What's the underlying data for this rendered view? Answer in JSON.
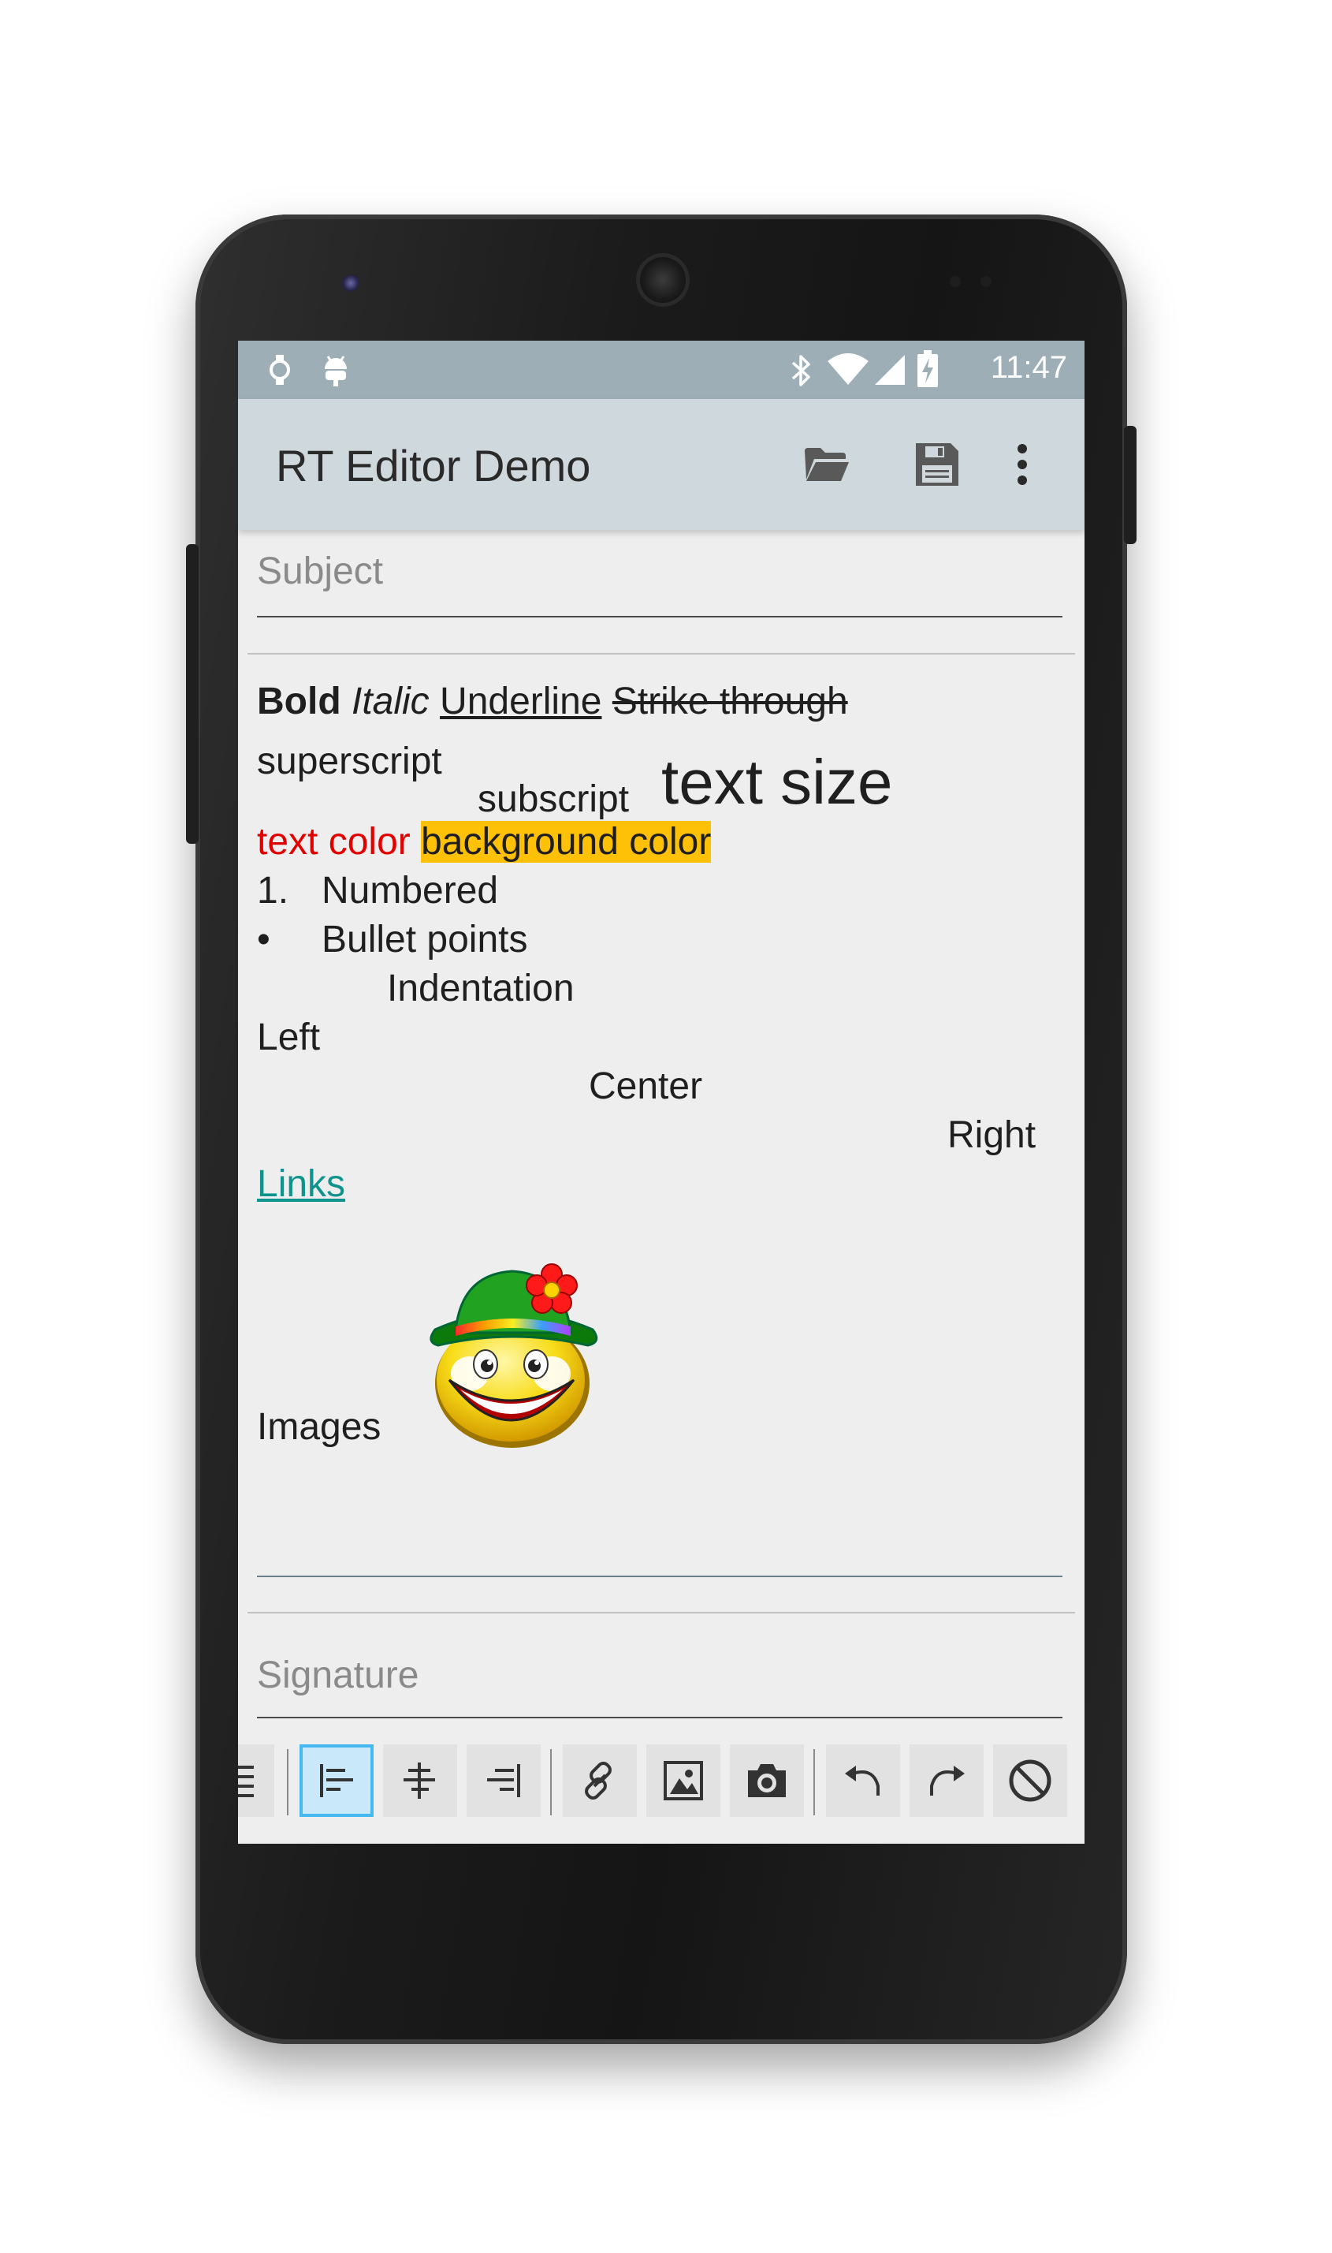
{
  "statusbar": {
    "time": "11:47",
    "icons": [
      "watch-icon",
      "android-icon",
      "bluetooth-icon",
      "wifi-icon",
      "signal-icon",
      "battery-icon"
    ]
  },
  "appbar": {
    "title": "RT Editor Demo",
    "actions": [
      "folder-open-icon",
      "save-icon",
      "more-vert-icon"
    ]
  },
  "subject": {
    "placeholder": "Subject"
  },
  "editor": {
    "bold": "Bold",
    "italic": "Italic",
    "underline": "Underline",
    "strike": "Strike through",
    "superscript": "superscript",
    "subscript": "subscript",
    "text_size": "text size",
    "text_color": "text color",
    "background_color": "background color",
    "numbered_marker": "1.",
    "numbered_label": "Numbered",
    "bullet_marker": "•",
    "bullet_label": "Bullet points",
    "indentation": "Indentation",
    "left": "Left",
    "center": "Center",
    "right": "Right",
    "links": "Links",
    "images": "Images"
  },
  "signature": {
    "placeholder": "Signature"
  },
  "toolbar": {
    "buttons": [
      "justify-icon",
      "align-left-icon",
      "align-center-icon",
      "align-right-icon",
      "link-icon",
      "image-icon",
      "camera-icon",
      "undo-icon",
      "redo-icon",
      "clear-format-icon"
    ],
    "active": "align-left-icon"
  },
  "colors": {
    "statusbar": "#9eaeb6",
    "appbar": "#cfd8dc",
    "text_color": "#e00000",
    "highlight": "#ffc107",
    "link": "#0e948c",
    "active_button": "#45b8f0"
  }
}
